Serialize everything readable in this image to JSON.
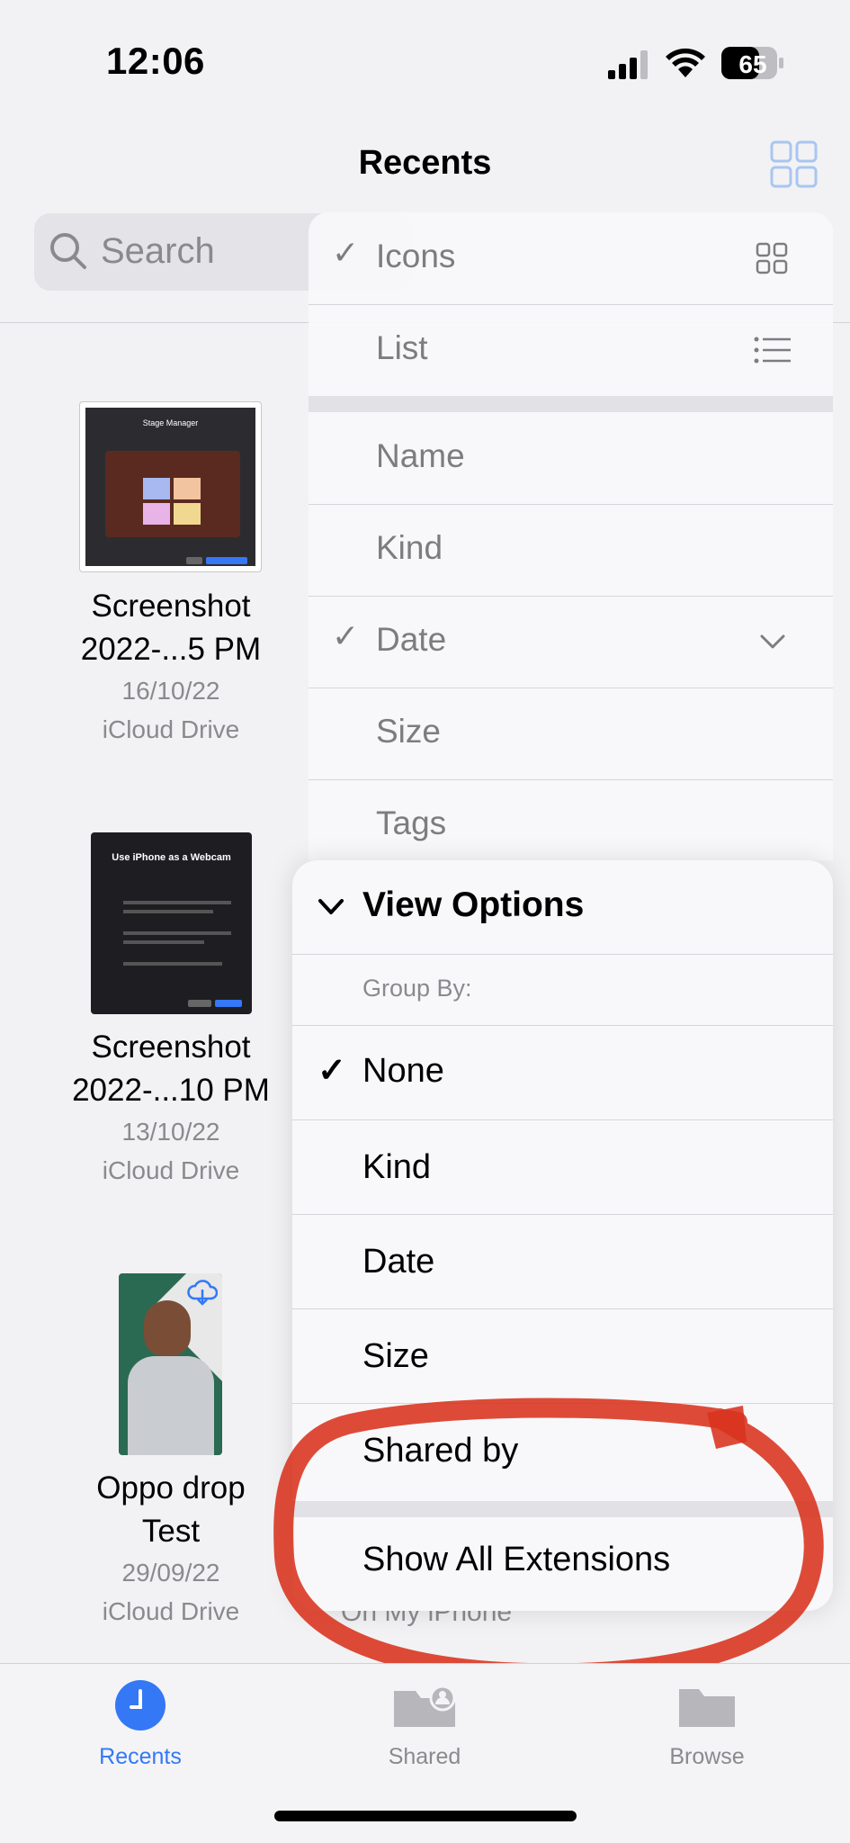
{
  "status_bar": {
    "time": "12:06",
    "battery": "65"
  },
  "header": {
    "title": "Recents"
  },
  "search": {
    "placeholder": "Search"
  },
  "files": [
    {
      "name_line1": "Screenshot",
      "name_line2": "2022-...5 PM",
      "date": "16/10/22",
      "location": "iCloud Drive"
    },
    {
      "name_line1": "Screenshot",
      "name_line2": "2022-...10 PM",
      "date": "13/10/22",
      "location": "iCloud Drive"
    },
    {
      "name_line1": "Oppo drop",
      "name_line2": "Test",
      "date": "29/09/22",
      "location": "iCloud Drive"
    }
  ],
  "thumbnails": {
    "stage_manager_title": "Stage Manager",
    "webcam_title": "Use iPhone as a Webcam"
  },
  "sort_menu": {
    "icons": "Icons",
    "list": "List",
    "name": "Name",
    "kind": "Kind",
    "date": "Date",
    "size": "Size",
    "tags": "Tags"
  },
  "view_options": {
    "title": "View Options",
    "group_by": "Group By:",
    "items": [
      "None",
      "Kind",
      "Date",
      "Size",
      "Shared by"
    ],
    "show_all_extensions": "Show All Extensions"
  },
  "behind_text": "On My iPhone",
  "tabs": {
    "recents": "Recents",
    "shared": "Shared",
    "browse": "Browse"
  },
  "colors": {
    "accent": "#3478f6",
    "annotation": "#d8321c"
  }
}
